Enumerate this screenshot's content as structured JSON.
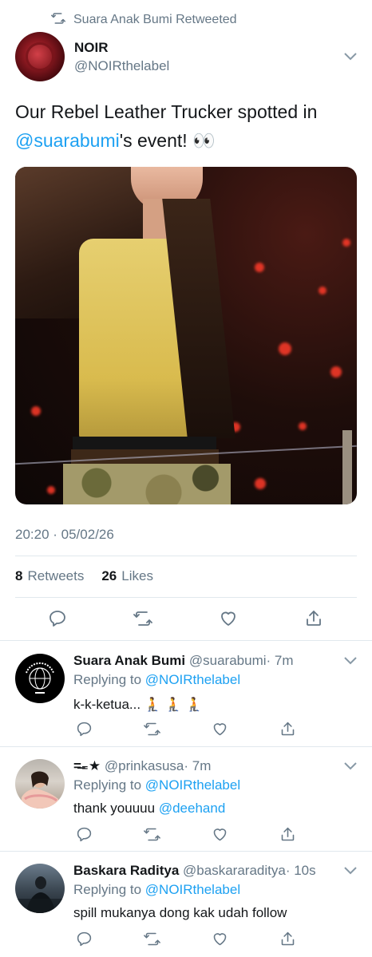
{
  "retweet": {
    "label": "Suara Anak Bumi Retweeted"
  },
  "tweet": {
    "name": "NOIR",
    "handle": "@NOIRthelabel",
    "text_before": "Our Rebel Leather Trucker spotted in",
    "mention": "@suarabumi",
    "text_after": "'s event! 👀",
    "timestamp": "20:20 · 05/02/26",
    "retweets_count": "8",
    "retweets_label": "Retweets",
    "likes_count": "26",
    "likes_label": "Likes"
  },
  "replies": [
    {
      "name": "Suara Anak Bumi",
      "handle": "@suarabumi",
      "time": "· 7m",
      "replying_label": "Replying to",
      "replying_to": "@NOIRthelabel",
      "text": "k-k-ketua... 🧎 🧎 🧎",
      "mention": ""
    },
    {
      "name": "=̶₌★",
      "handle": "@prinkasusa",
      "time": "· 7m",
      "replying_label": "Replying to",
      "replying_to": "@NOIRthelabel",
      "text": "thank youuuu",
      "mention": "@deehand"
    },
    {
      "name": "Baskara Raditya",
      "handle": "@baskararaditya",
      "time": "· 10s",
      "replying_label": "Replying to",
      "replying_to": "@NOIRthelabel",
      "text": "spill mukanya dong kak udah follow",
      "mention": ""
    }
  ],
  "icons": {
    "retweet": "retweet-icon",
    "reply": "reply-icon",
    "like": "heart-icon",
    "share": "share-icon",
    "menu": "chevron-down-icon"
  },
  "colors": {
    "link": "#1da1f2",
    "muted": "#657786",
    "text": "#14171a"
  }
}
